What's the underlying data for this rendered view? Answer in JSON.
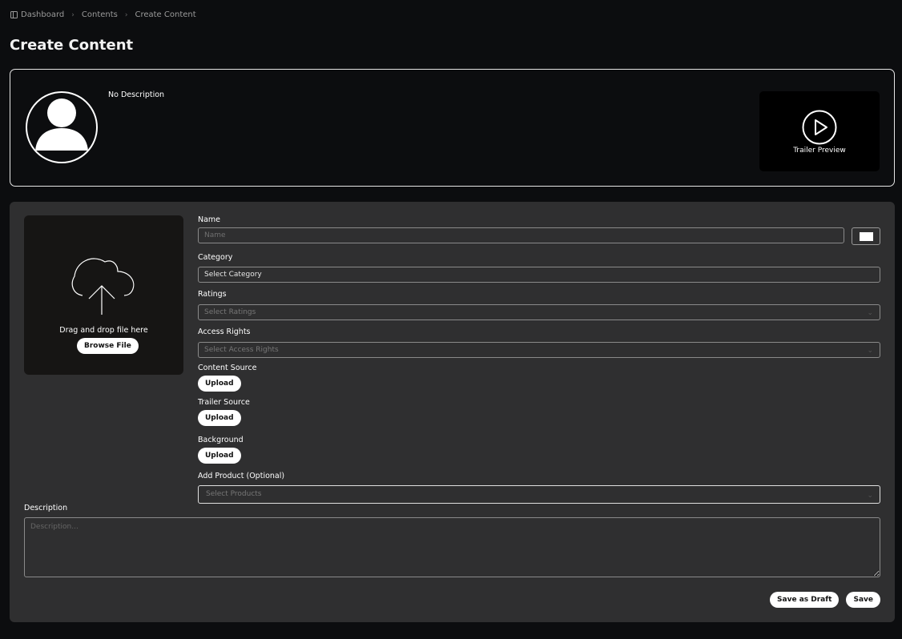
{
  "breadcrumb": {
    "items": [
      "Dashboard",
      "Contents",
      "Create Content"
    ]
  },
  "page_title": "Create Content",
  "preview": {
    "description": "No Description",
    "trailer_label": "Trailer Preview"
  },
  "dropzone": {
    "text": "Drag and drop file here",
    "browse_label": "Browse File"
  },
  "form": {
    "name_label": "Name",
    "name_placeholder": "Name",
    "category_label": "Category",
    "category_value": "Select Category",
    "ratings_label": "Ratings",
    "ratings_placeholder": "Select Ratings",
    "access_label": "Access Rights",
    "access_placeholder": "Select Access Rights",
    "content_source_label": "Content Source",
    "trailer_source_label": "Trailer Source",
    "background_label": "Background",
    "upload_label": "Upload",
    "product_label": "Add Product (Optional)",
    "product_placeholder": "Select Products",
    "description_label": "Description",
    "description_placeholder": "Description..."
  },
  "actions": {
    "save_draft": "Save as Draft",
    "save": "Save"
  },
  "icons": {
    "breadcrumb_icon": "sidebar-panel-icon",
    "avatar": "user-silhouette-icon",
    "play": "play-circle-icon",
    "upload": "cloud-upload-icon",
    "chevron": "chevron-down-icon"
  },
  "colors": {
    "background": "#0c0d0f",
    "panel": "#2f2f30",
    "dropzone": "#161514",
    "text": "#ffffff",
    "muted": "#9a9a9a"
  }
}
